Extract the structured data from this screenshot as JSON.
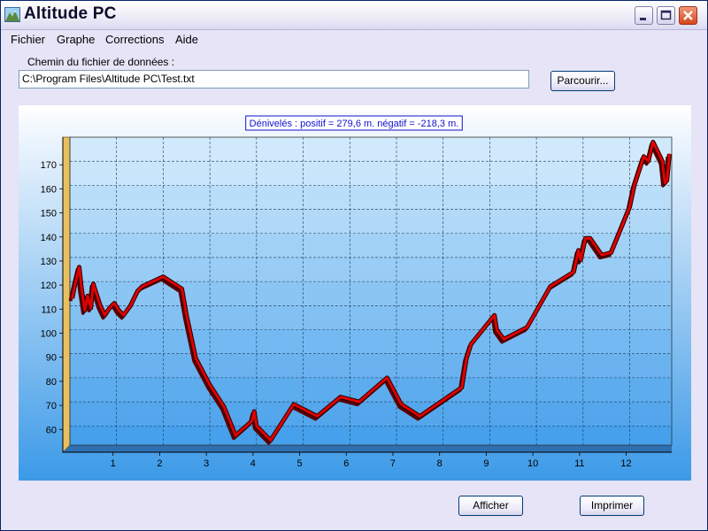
{
  "window": {
    "title": "Altitude PC"
  },
  "menu": {
    "items": [
      "Fichier",
      "Graphe",
      "Corrections",
      "Aide"
    ]
  },
  "file": {
    "label": "Chemin du fichier de données :",
    "path": "C:\\Program Files\\Altitude PC\\Test.txt",
    "browse_label": "Parcourir..."
  },
  "buttons": {
    "show_label": "Afficher",
    "print_label": "Imprimer"
  },
  "icons": [
    "app-icon",
    "minimize-icon",
    "maximize-icon",
    "close-icon"
  ],
  "colors": {
    "line": "#e00000",
    "line_dark": "#5a0000",
    "axis_wall": "#e8c060",
    "title_text": "#1010d0"
  },
  "chart_data": {
    "type": "line",
    "title": "Dénivelés : positif = 279,6 m.  négatif = -218,3 m.",
    "xlabel": "",
    "ylabel": "",
    "xlim": [
      0,
      12.9
    ],
    "ylim": [
      52,
      180
    ],
    "x_ticks": [
      1,
      2,
      3,
      4,
      5,
      6,
      7,
      8,
      9,
      10,
      11,
      12
    ],
    "y_ticks": [
      60,
      70,
      80,
      90,
      100,
      110,
      120,
      130,
      140,
      150,
      160,
      170
    ],
    "grid": true,
    "series": [
      {
        "x": [
          0.05,
          0.1,
          0.2,
          0.25,
          0.32,
          0.38,
          0.45,
          0.5,
          0.55,
          0.65,
          0.75,
          0.85,
          0.95,
          1.05,
          1.15,
          1.3,
          1.45,
          1.55,
          2.0,
          2.4,
          2.5,
          2.7,
          3.0,
          3.3,
          3.55,
          3.9,
          3.95,
          4.0,
          4.1,
          4.3,
          4.5,
          4.8,
          5.3,
          5.8,
          6.2,
          6.8,
          7.1,
          7.5,
          8.4,
          8.5,
          8.6,
          9.1,
          9.15,
          9.3,
          9.8,
          10.3,
          10.8,
          10.9,
          10.95,
          11.05,
          11.15,
          11.4,
          11.6,
          12.0,
          12.1,
          12.3,
          12.4,
          12.5,
          12.7,
          12.75,
          12.8,
          12.85
        ],
        "y": [
          113,
          118,
          126,
          117,
          108,
          114,
          109,
          119,
          116,
          110,
          106,
          109,
          111,
          108,
          106,
          110,
          116,
          118,
          122,
          117,
          106,
          88,
          77,
          68,
          56,
          62,
          66,
          60,
          58,
          54,
          60,
          69,
          64,
          72,
          70,
          80,
          69,
          64,
          76,
          88,
          94,
          106,
          100,
          96,
          101,
          118,
          124,
          133,
          129,
          138,
          138,
          131,
          132,
          151,
          160,
          172,
          170,
          178,
          170,
          161,
          162,
          173
        ]
      }
    ]
  }
}
